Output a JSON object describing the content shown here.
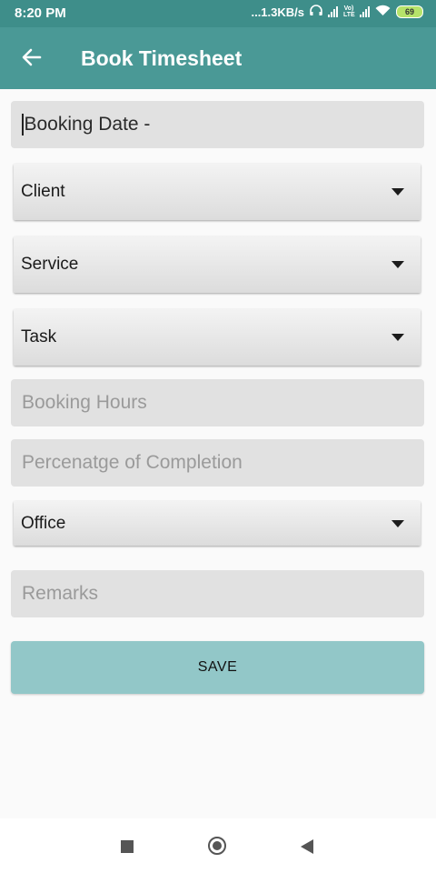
{
  "status": {
    "time": "8:20 PM",
    "speed": "...1.3KB/s",
    "network_label": "Vo) LTE",
    "battery": "69"
  },
  "appbar": {
    "title": "Book Timesheet",
    "back_icon": "arrow-left-icon"
  },
  "form": {
    "booking_date": "Booking Date -",
    "client": "Client",
    "service": "Service",
    "task": "Task",
    "booking_hours_placeholder": "Booking Hours",
    "completion_placeholder": "Percenatge of Completion",
    "office": "Office",
    "remarks_placeholder": "Remarks",
    "save_label": "SAVE"
  },
  "colors": {
    "statusbar": "#3e8e8a",
    "appbar": "#4a9996",
    "save_button": "#92c7c8",
    "field_bg": "#e1e1e1"
  }
}
